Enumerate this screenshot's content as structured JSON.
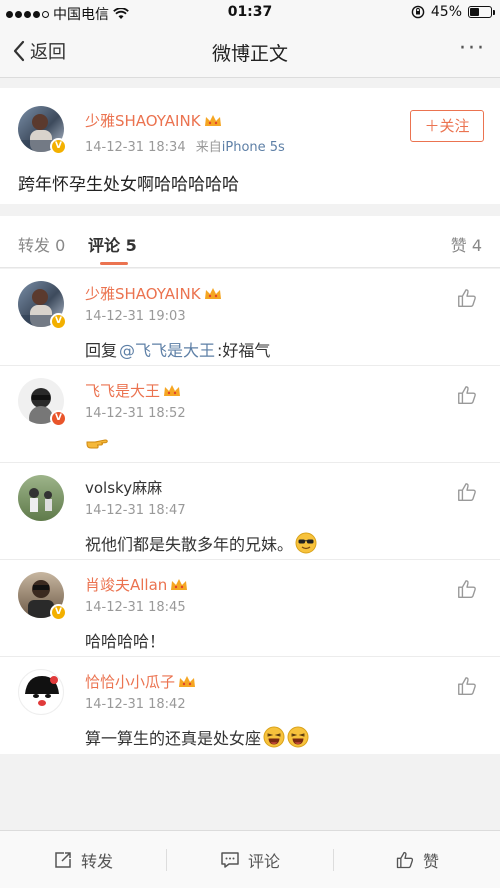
{
  "status_bar": {
    "carrier": "中国电信",
    "time": "01:37",
    "battery": "45%",
    "battery_level": 0.45
  },
  "nav": {
    "back_label": "返回",
    "title": "微博正文",
    "more_label": "···"
  },
  "post": {
    "author": "少雅SHAOYAINK",
    "time": "14-12-31 18:34",
    "source_prefix": "来自",
    "source": "iPhone 5s",
    "follow_label": "＋关注",
    "text": "跨年怀孕生处女啊哈哈哈哈哈"
  },
  "tabs": {
    "repost_label": "转发",
    "repost_count": "0",
    "comment_label": "评论",
    "comment_count": "5",
    "like_label": "赞",
    "like_count": "4"
  },
  "comments": [
    {
      "author": "少雅SHAOYAINK",
      "time": "14-12-31 19:03",
      "text_prefix": "回复",
      "mention": "@飞飞是大王",
      "text": ":好福气"
    },
    {
      "author": "飞飞是大王",
      "time": "14-12-31 18:52",
      "text": ""
    },
    {
      "author": "volsky麻麻",
      "time": "14-12-31 18:47",
      "text": "祝他们都是失散多年的兄妹。"
    },
    {
      "author": "肖竣夫Allan",
      "time": "14-12-31 18:45",
      "text": "哈哈哈哈！"
    },
    {
      "author": "恰恰小小瓜子",
      "time": "14-12-31 18:42",
      "text": "算一算生的还真是处女座"
    }
  ],
  "bottom_bar": {
    "repost_label": "转发",
    "comment_label": "评论",
    "like_label": "赞"
  },
  "colors": {
    "accent": "#eb7350",
    "link": "#5d7fa6",
    "meta": "#999999"
  },
  "icons": [
    "signal-dots-icon",
    "wifi-icon",
    "lock-rotation-icon",
    "battery-icon",
    "back-chevron-icon",
    "more-icon",
    "verified-badge-icon",
    "vip-crown-icon",
    "thumbs-up-icon",
    "pointing-hand-emoji",
    "sunglasses-emoji",
    "laughing-emoji",
    "repost-icon",
    "comment-icon"
  ]
}
